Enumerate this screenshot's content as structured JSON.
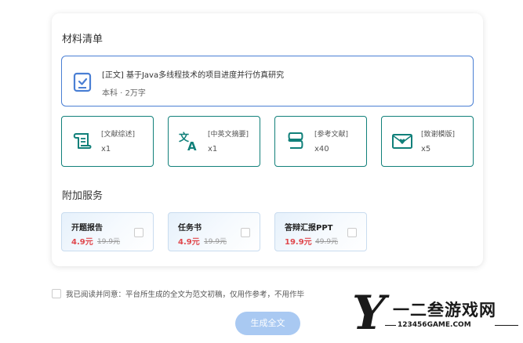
{
  "sections": {
    "materials_title": "材料清单",
    "services_title": "附加服务"
  },
  "main_doc": {
    "title": "[正文] 基于Java多线程技术的项目进度并行仿真研究",
    "subtitle": "本科 · 2万字",
    "icon": "checked-document-icon"
  },
  "materials": [
    {
      "label": "[文献综述]",
      "count": "x1",
      "icon": "scroll-icon"
    },
    {
      "label": "[中英文摘要]",
      "count": "x1",
      "icon": "translate-icon"
    },
    {
      "label": "[参考文献]",
      "count": "x40",
      "icon": "book-stack-icon"
    },
    {
      "label": "[致谢模版]",
      "count": "x5",
      "icon": "heart-envelope-icon"
    }
  ],
  "services": [
    {
      "name": "开题报告",
      "price": "4.9元",
      "original": "19.9元"
    },
    {
      "name": "任务书",
      "price": "4.9元",
      "original": "19.9元"
    },
    {
      "name": "答辩汇报PPT",
      "price": "19.9元",
      "original": "49.9元"
    }
  ],
  "agreement": {
    "text": "我已阅读并同意：平台所生成的全文为范文初稿，仅用作参考，不用作毕"
  },
  "generate_button": "生成全文",
  "watermark": {
    "letter": "Y",
    "main": "一二叁游戏网",
    "sub": "123456GAME.COM"
  },
  "colors": {
    "primary_blue": "#4a7fd4",
    "teal": "#11807a",
    "price_red": "#e0484d",
    "button_disabled": "#a9c9f2"
  }
}
